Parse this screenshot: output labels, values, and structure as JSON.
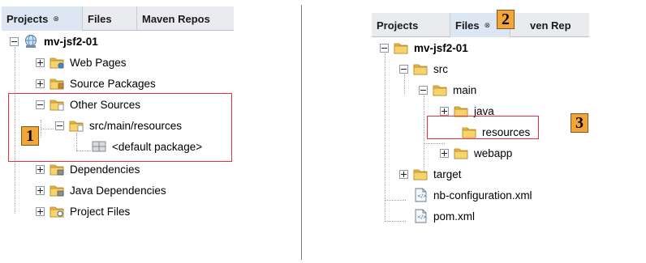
{
  "left_panel": {
    "tabs": [
      {
        "label": "Projects",
        "active": true,
        "close": "⊗"
      },
      {
        "label": "Files",
        "active": false
      },
      {
        "label": "Maven Repos",
        "active": false
      }
    ],
    "tree": [
      {
        "label": "mv-jsf2-01",
        "icon": "globe-project-icon"
      },
      {
        "label": "Web Pages",
        "icon": "folder-web-icon"
      },
      {
        "label": "Source Packages",
        "icon": "package-folder-icon"
      },
      {
        "label": "Other Sources",
        "icon": "sources-folder-icon"
      },
      {
        "label": "src/main/resources",
        "icon": "sources-folder-icon"
      },
      {
        "label": "<default package>",
        "icon": "package-icon"
      },
      {
        "label": "Dependencies",
        "icon": "library-folder-icon"
      },
      {
        "label": "Java Dependencies",
        "icon": "library-folder-icon"
      },
      {
        "label": "Project Files",
        "icon": "project-files-folder-icon"
      }
    ],
    "callout": "1"
  },
  "right_panel": {
    "tabs": [
      {
        "label": "Projects",
        "active": false
      },
      {
        "label": "Files",
        "active": true,
        "close": "⊗"
      },
      {
        "label": "ven Rep",
        "active": false
      }
    ],
    "tree": [
      {
        "label": "mv-jsf2-01",
        "icon": "folder-project-icon"
      },
      {
        "label": "src",
        "icon": "folder-icon"
      },
      {
        "label": "main",
        "icon": "folder-icon"
      },
      {
        "label": "java",
        "icon": "folder-icon"
      },
      {
        "label": "resources",
        "icon": "folder-icon"
      },
      {
        "label": "webapp",
        "icon": "folder-icon"
      },
      {
        "label": "target",
        "icon": "folder-icon"
      },
      {
        "label": "nb-configuration.xml",
        "icon": "xml-file-icon"
      },
      {
        "label": "pom.xml",
        "icon": "xml-file-icon"
      }
    ],
    "callouts": [
      "2",
      "3"
    ]
  },
  "colors": {
    "highlight_box": "#e8303a",
    "callout_fill": "#f4a53a",
    "folder_yellow": "#f0c24b",
    "tab_active": "#dde6f3"
  }
}
